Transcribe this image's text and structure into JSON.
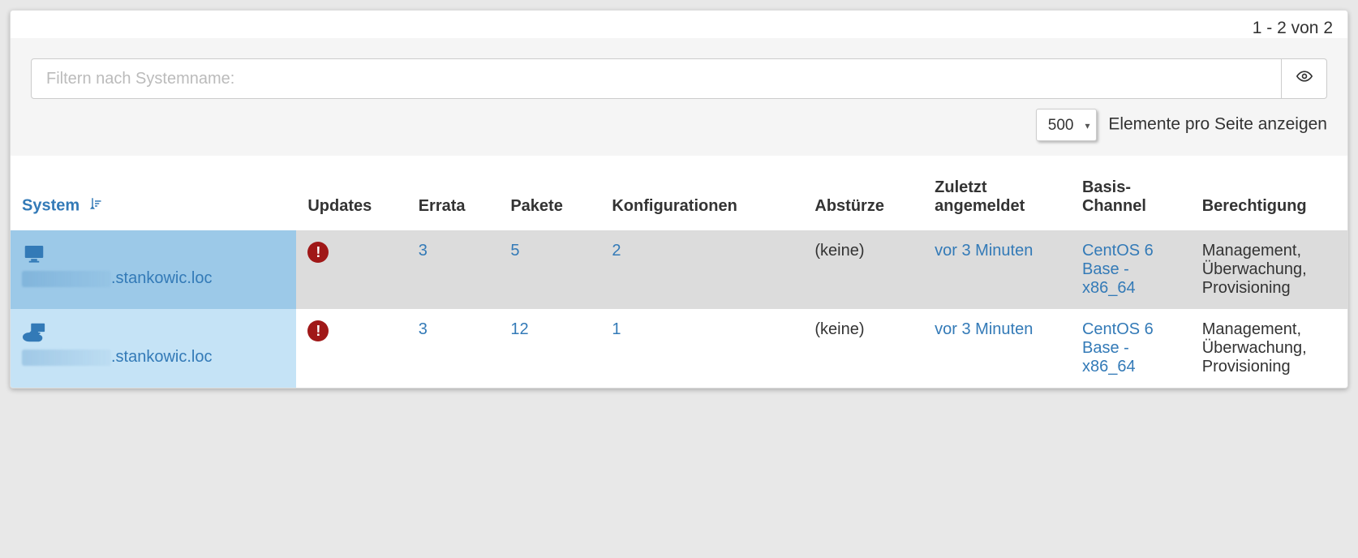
{
  "topbar": {
    "count_text": "1 - 2 von 2"
  },
  "filter": {
    "placeholder": "Filtern nach Systemname:",
    "per_page_value": "500",
    "per_page_label": "Elemente pro Seite anzeigen"
  },
  "columns": {
    "system": "System",
    "updates": "Updates",
    "errata": "Errata",
    "pakete": "Pakete",
    "konfig": "Konfigurationen",
    "absturz": "Abstürze",
    "zuletzt": "Zuletzt angemeldet",
    "channel": "Basis-Channel",
    "berecht": "Berechtigung"
  },
  "rows": [
    {
      "icon_type": "desktop",
      "system_name_suffix": ".stankowic.loc",
      "errata": "3",
      "pakete": "5",
      "konfig": "2",
      "absturz": "(keine)",
      "zuletzt": "vor 3 Minuten",
      "channel": "CentOS 6 Base - x86_64",
      "berecht": "Management, Überwachung, Provisioning"
    },
    {
      "icon_type": "cloud-desktop",
      "system_name_suffix": ".stankowic.loc",
      "errata": "3",
      "pakete": "12",
      "konfig": "1",
      "absturz": "(keine)",
      "zuletzt": "vor 3 Minuten",
      "channel": "CentOS 6 Base - x86_64",
      "berecht": "Management, Überwachung, Provisioning"
    }
  ]
}
